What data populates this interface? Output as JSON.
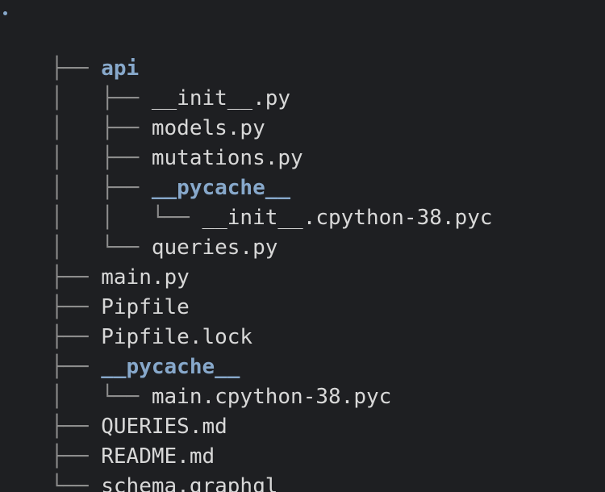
{
  "tree": {
    "root_symbol": ".",
    "entries": [
      {
        "prefix": "├── ",
        "name": "api",
        "type": "directory"
      },
      {
        "prefix": "│   ├── ",
        "name": "__init__.py",
        "type": "file"
      },
      {
        "prefix": "│   ├── ",
        "name": "models.py",
        "type": "file"
      },
      {
        "prefix": "│   ├── ",
        "name": "mutations.py",
        "type": "file"
      },
      {
        "prefix": "│   ├── ",
        "name": "__pycache__",
        "type": "directory"
      },
      {
        "prefix": "│   │   └── ",
        "name": "__init__.cpython-38.pyc",
        "type": "file"
      },
      {
        "prefix": "│   └── ",
        "name": "queries.py",
        "type": "file"
      },
      {
        "prefix": "├── ",
        "name": "main.py",
        "type": "file"
      },
      {
        "prefix": "├── ",
        "name": "Pipfile",
        "type": "file"
      },
      {
        "prefix": "├── ",
        "name": "Pipfile.lock",
        "type": "file"
      },
      {
        "prefix": "├── ",
        "name": "__pycache__",
        "type": "directory"
      },
      {
        "prefix": "│   └── ",
        "name": "main.cpython-38.pyc",
        "type": "file"
      },
      {
        "prefix": "├── ",
        "name": "QUERIES.md",
        "type": "file"
      },
      {
        "prefix": "├── ",
        "name": "README.md",
        "type": "file"
      },
      {
        "prefix": "└── ",
        "name": "schema.graphql",
        "type": "file"
      }
    ]
  },
  "colors": {
    "background": "#1e1f22",
    "file_text": "#d8d8d8",
    "directory_text": "#87a8cb",
    "tree_guides": "#8d8d8d"
  }
}
